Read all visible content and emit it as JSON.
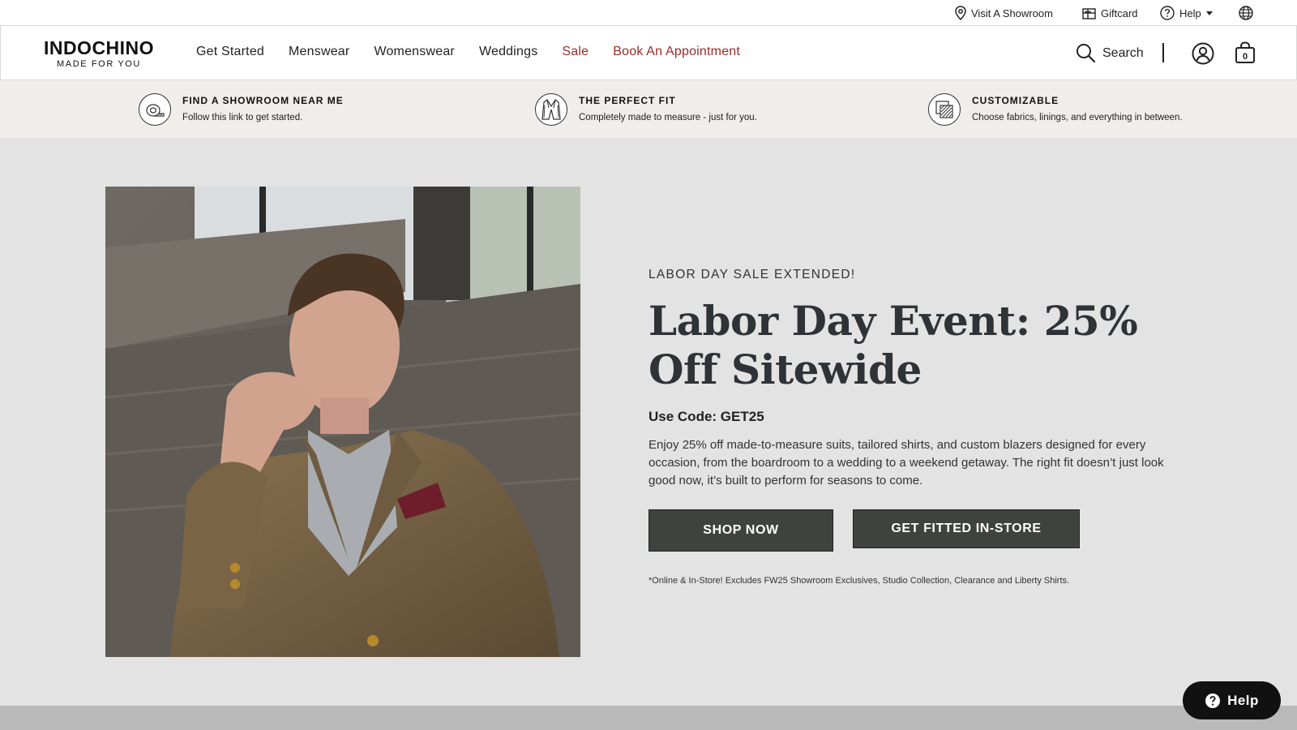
{
  "utility_bar": {
    "showroom_label": "Visit A Showroom",
    "giftcard_label": "Giftcard",
    "help_label": "Help",
    "icons": [
      "location-pin-icon",
      "gift-icon",
      "question-circle-icon",
      "globe-icon"
    ]
  },
  "header": {
    "logo_name": "INDOCHINO",
    "logo_tagline": "MADE FOR YOU",
    "nav": [
      {
        "label": "Get Started",
        "accent": false
      },
      {
        "label": "Menswear",
        "accent": false
      },
      {
        "label": "Womenswear",
        "accent": false
      },
      {
        "label": "Weddings",
        "accent": false
      },
      {
        "label": "Sale",
        "accent": true
      },
      {
        "label": "Book An Appointment",
        "accent": true
      }
    ],
    "search_label": "Search",
    "cart_count": "0"
  },
  "value_props": [
    {
      "title": "FIND A SHOWROOM NEAR ME",
      "subtitle": "Follow this link to get started.",
      "icon": "tape-measure-icon"
    },
    {
      "title": "THE PERFECT FIT",
      "subtitle": "Completely made to measure - just for you.",
      "icon": "suit-jacket-icon"
    },
    {
      "title": "CUSTOMIZABLE",
      "subtitle": "Choose fabrics, linings, and everything in between.",
      "icon": "fabric-swatch-icon"
    }
  ],
  "hero": {
    "eyebrow": "LABOR DAY SALE EXTENDED!",
    "headline": "Labor Day Event: 25% Off Sitewide",
    "code": "Use Code: GET25",
    "body": "Enjoy 25% off made-to-measure suits, tailored shirts, and custom blazers designed for every occasion, from the boardroom to a wedding to a weekend getaway. The right fit doesn’t just look good now, it’s built to perform for seasons to come.",
    "cta_primary": "SHOP NOW",
    "cta_secondary": "GET FITTED IN-STORE",
    "disclaimer": "*Online & In-Store! Excludes FW25 Showroom Exclusives, Studio Collection, Clearance and Liberty Shirts."
  },
  "help_widget": {
    "label": "Help"
  },
  "colors": {
    "accent_red": "#9b2a2a",
    "button_dark": "#3e433f",
    "hero_bg": "#e3e3e3",
    "strip_bg": "#efeeeb"
  }
}
